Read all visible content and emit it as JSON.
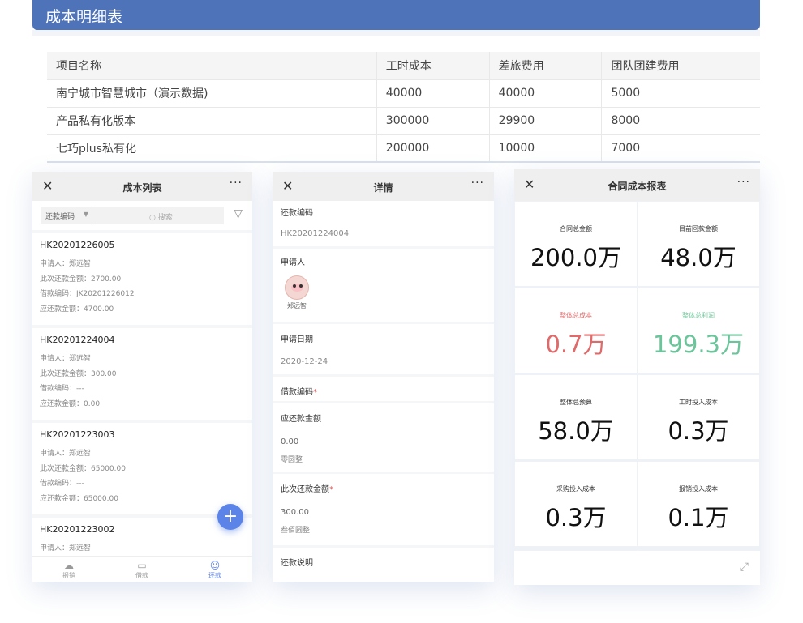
{
  "header": {
    "title": "成本明细表"
  },
  "table": {
    "columns": [
      "项目名称",
      "工时成本",
      "差旅费用",
      "团队团建费用"
    ],
    "rows": [
      [
        "南宁城市智慧城市（演示数据)",
        "40000",
        "40000",
        "5000"
      ],
      [
        "产品私有化版本",
        "300000",
        "29900",
        "8000"
      ],
      [
        "七巧plus私有化",
        "200000",
        "10000",
        "7000"
      ]
    ]
  },
  "list_panel": {
    "title": "成本列表",
    "close": "✕",
    "more": "···",
    "filter_select": "还款编码",
    "search_placeholder": "搜索",
    "cards": [
      {
        "code": "HK20201226005",
        "applicant": "申请人：郑远智",
        "this_repay": "此次还款金额：2700.00",
        "loan_code": "借款编码：JK20201226012",
        "due": "应还款金额：4700.00"
      },
      {
        "code": "HK20201224004",
        "applicant": "申请人：郑远智",
        "this_repay": "此次还款金额：300.00",
        "loan_code": "借款编码：---",
        "due": "应还款金额：0.00"
      },
      {
        "code": "HK20201223003",
        "applicant": "申请人：郑远智",
        "this_repay": "此次还款金额：65000.00",
        "loan_code": "借款编码：---",
        "due": "应还款金额：65000.00"
      },
      {
        "code": "HK20201223002",
        "applicant": "申请人：郑远智"
      }
    ],
    "fab": "+",
    "tabs": [
      {
        "label": "报销",
        "icon": "cloud-icon"
      },
      {
        "label": "借款",
        "icon": "ticket-icon"
      },
      {
        "label": "还款",
        "icon": "person-icon"
      }
    ]
  },
  "detail_panel": {
    "title": "详情",
    "close": "✕",
    "more": "···",
    "repay_code_label": "还款编码",
    "repay_code_value": "HK20201224004",
    "applicant_label": "申请人",
    "applicant_name": "郑远智",
    "date_label": "申请日期",
    "date_value": "2020-12-24",
    "loan_code_label": "借款编码",
    "due_label": "应还款金额",
    "due_value": "0.00",
    "due_words": "零圆整",
    "this_repay_label": "此次还款金额",
    "this_repay_value": "300.00",
    "this_repay_words": "叁佰圆整",
    "note_label": "还款说明",
    "required_mark": "*"
  },
  "report_panel": {
    "title": "合同成本报表",
    "close": "✕",
    "more": "···",
    "cells": [
      {
        "label": "合同总金额",
        "value": "200.0万",
        "color": "#111111"
      },
      {
        "label": "目前回款金额",
        "value": "48.0万",
        "color": "#111111"
      },
      {
        "label": "整体总成本",
        "value": "0.7万",
        "color": "#e06a6a"
      },
      {
        "label": "整体总利润",
        "value": "199.3万",
        "color": "#6cc59a"
      },
      {
        "label": "整体总预算",
        "value": "58.0万",
        "color": "#111111"
      },
      {
        "label": "工时投入成本",
        "value": "0.3万",
        "color": "#111111"
      },
      {
        "label": "采购投入成本",
        "value": "0.3万",
        "color": "#111111"
      },
      {
        "label": "报销投入成本",
        "value": "0.1万",
        "color": "#111111"
      }
    ]
  }
}
